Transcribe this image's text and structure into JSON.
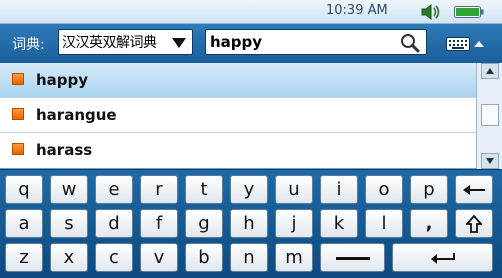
{
  "status": {
    "time": "10:39 AM",
    "volume_icon": "speaker-icon",
    "battery_icon": "battery-icon"
  },
  "header": {
    "dict_label": "词典:",
    "dict_select_value": "汉汉英双解词典",
    "search_value": "happy",
    "search_icon": "search-icon",
    "keyboard_icon": "keyboard-icon"
  },
  "list": {
    "items": [
      {
        "label": "happy",
        "selected": true
      },
      {
        "label": "harangue",
        "selected": false
      },
      {
        "label": "harass",
        "selected": false
      }
    ]
  },
  "keyboard": {
    "row1": [
      "q",
      "w",
      "e",
      "r",
      "t",
      "y",
      "u",
      "i",
      "o",
      "p"
    ],
    "row2": [
      "a",
      "s",
      "d",
      "f",
      "g",
      "h",
      "j",
      "k",
      "l",
      ","
    ],
    "row3": [
      "z",
      "x",
      "c",
      "v",
      "b",
      "n",
      "m"
    ],
    "special_icons": [
      "backspace-icon",
      "shift-icon",
      "space-icon",
      "enter-icon"
    ]
  },
  "colors": {
    "header_bg": "#1f6aa6",
    "keyboard_bg": "#0c4a80",
    "selected_row": "#b9dcf3",
    "bullet": "#f07a1a"
  }
}
